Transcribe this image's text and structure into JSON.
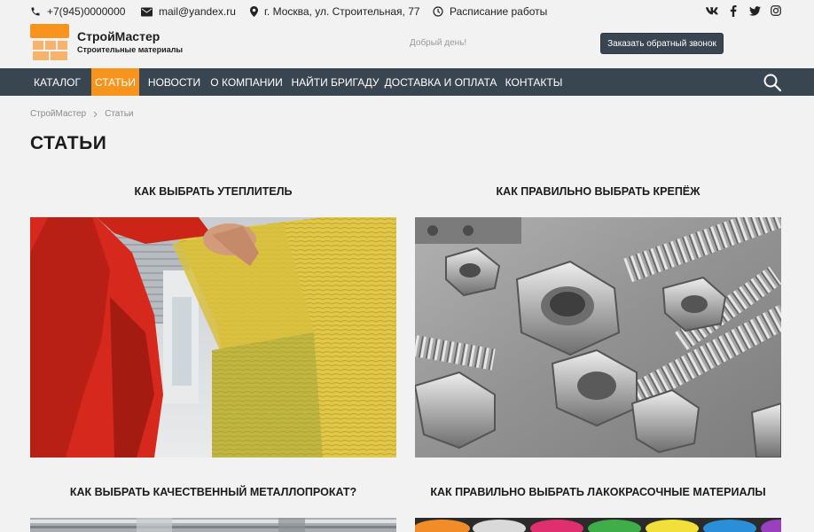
{
  "topbar": {
    "phone": "+7(945)0000000",
    "email": "mail@yandex.ru",
    "address": "г. Москва, ул. Строительная, 77",
    "schedule": "Расписание работы",
    "socials": [
      "vk-icon",
      "facebook-icon",
      "twitter-icon",
      "instagram-icon"
    ]
  },
  "header": {
    "brand_name": "СтройМастер",
    "brand_sub": "Строительные материалы",
    "greeting": "Добрый день!",
    "callback_label": "Заказать обратный звонок"
  },
  "nav": {
    "items": [
      {
        "label": "КАТАЛОГ"
      },
      {
        "label": "СТАТЬИ",
        "active": true
      },
      {
        "label": "НОВОСТИ"
      },
      {
        "label": "О КОМПАНИИ"
      },
      {
        "label": "НАЙТИ БРИГАДУ"
      },
      {
        "label": "ДОСТАВКА И ОПЛАТА"
      },
      {
        "label": "КОНТАКТЫ"
      }
    ],
    "search_icon": "search-icon"
  },
  "breadcrumb": {
    "home": "СтройМастер",
    "current": "Статьи"
  },
  "page_title": "СТАТЬИ",
  "articles": [
    {
      "title": "КАК ВЫБРАТЬ УТЕПЛИТЕЛЬ"
    },
    {
      "title": "КАК ПРАВИЛЬНО ВЫБРАТЬ КРЕПЁЖ"
    },
    {
      "title": "КАК ВЫБРАТЬ КАЧЕСТВЕННЫЙ МЕТАЛЛОПРОКАТ?"
    },
    {
      "title": "КАК ПРАВИЛЬНО ВЫБРАТЬ ЛАКОКРАСОЧНЫЕ МАТЕРИАЛЫ"
    }
  ],
  "colors": {
    "accent": "#f7941d",
    "nav_bg": "#3a4552",
    "page_bg": "#f2f2f2"
  }
}
